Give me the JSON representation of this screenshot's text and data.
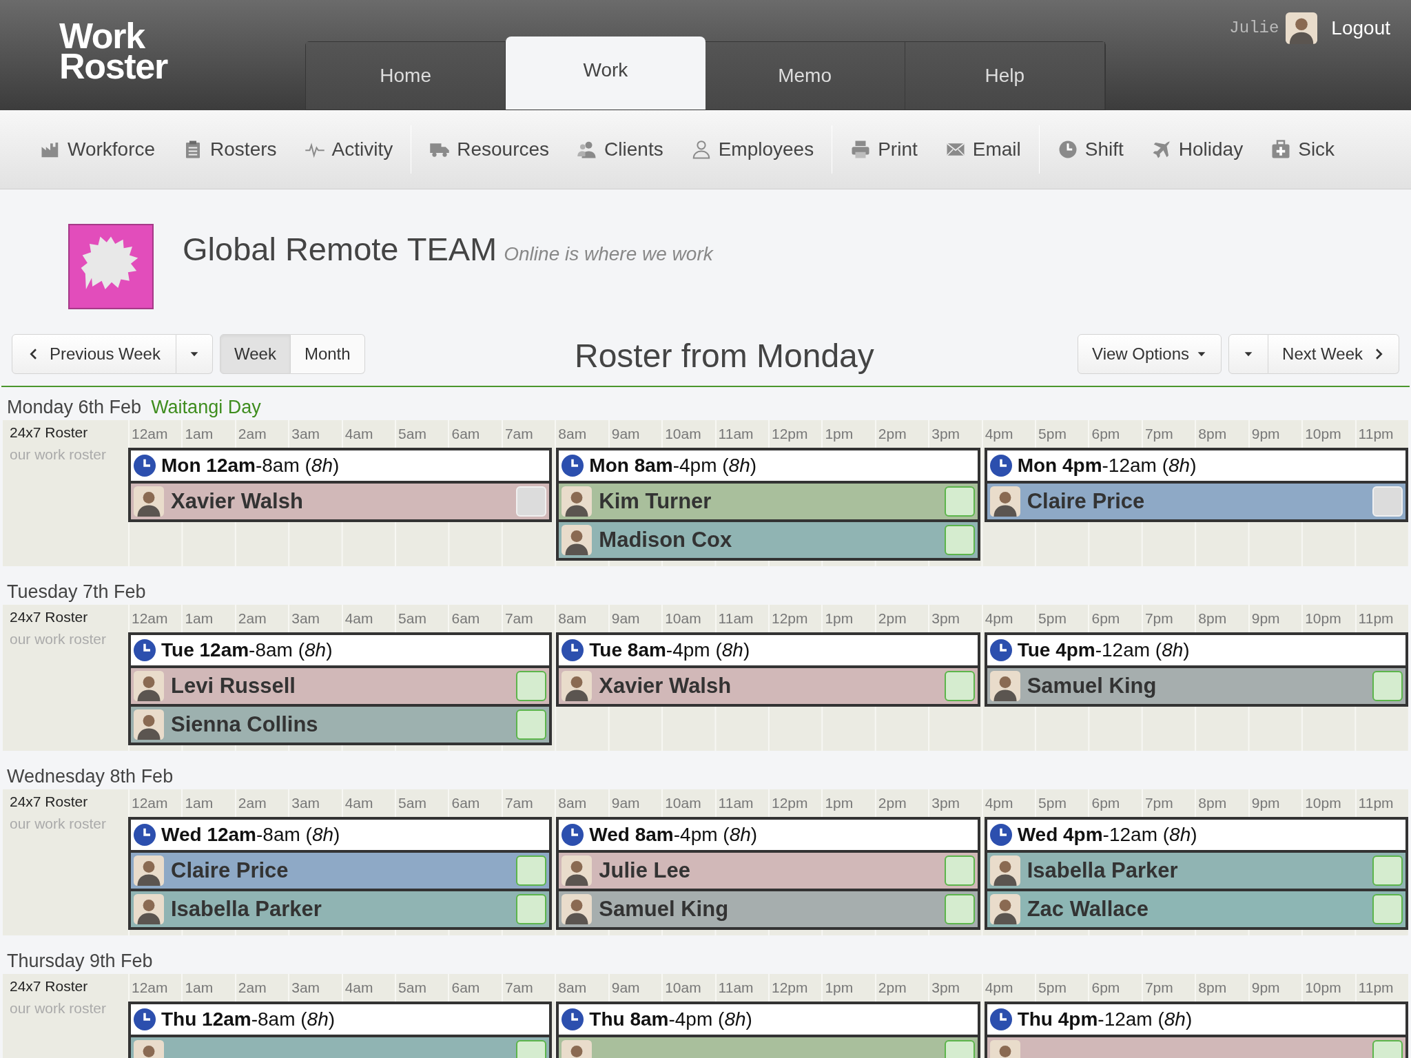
{
  "header": {
    "logo_lines": [
      "Work",
      "Roster"
    ],
    "tabs": [
      {
        "label": "Home",
        "selected": false
      },
      {
        "label": "Work",
        "selected": true
      },
      {
        "label": "Memo",
        "selected": false
      },
      {
        "label": "Help",
        "selected": false
      }
    ],
    "user": {
      "name": "Julie",
      "logout": "Logout"
    }
  },
  "toolbar": [
    [
      "Workforce",
      "Rosters",
      "Activity"
    ],
    [
      "Resources",
      "Clients",
      "Employees"
    ],
    [
      "Print",
      "Email"
    ],
    [
      "Shift",
      "Holiday",
      "Sick"
    ]
  ],
  "team": {
    "name": "Global Remote TEAM",
    "tagline": "Online is where we work"
  },
  "nav": {
    "previous": "Previous Week",
    "views": [
      {
        "label": "Week",
        "selected": true
      },
      {
        "label": "Month",
        "selected": false
      }
    ],
    "title": "Roster from Monday",
    "view_options": "View Options",
    "next": "Next Week"
  },
  "days": [
    {
      "title": "Monday 6th Feb",
      "holiday": "Waitangi Day",
      "roster": "24x7 Roster",
      "roster_note": "our work roster",
      "hours": [
        "12am",
        "1am",
        "2am",
        "3am",
        "4am",
        "5am",
        "6am",
        "7am",
        "8am",
        "9am",
        "10am",
        "11am",
        "12pm",
        "1pm",
        "2pm",
        "3pm",
        "4pm",
        "5pm",
        "6pm",
        "7pm",
        "8pm",
        "9pm",
        "10pm",
        "11pm"
      ],
      "shifts": [
        {
          "label": "**Mon 12am**-8am (*8h*)",
          "staff": [
            {
              "name": "Xavier Walsh",
              "color": "#d1b8b8",
              "confirmed": false
            }
          ]
        },
        {
          "label": "**Mon 8am**-4pm (*8h*)",
          "staff": [
            {
              "name": "Kim Turner",
              "color": "#a9bf9c",
              "confirmed": true
            },
            {
              "name": "Madison Cox",
              "color": "#90b4b3",
              "confirmed": true
            }
          ]
        },
        {
          "label": "**Mon 4pm**-12am (*8h*)",
          "staff": [
            {
              "name": "Claire Price",
              "color": "#8ea9c6",
              "confirmed": false
            }
          ]
        }
      ]
    },
    {
      "title": "Tuesday 7th Feb",
      "roster": "24x7 Roster",
      "roster_note": "our work roster",
      "hours": [
        "12am",
        "1am",
        "2am",
        "3am",
        "4am",
        "5am",
        "6am",
        "7am",
        "8am",
        "9am",
        "10am",
        "11am",
        "12pm",
        "1pm",
        "2pm",
        "3pm",
        "4pm",
        "5pm",
        "6pm",
        "7pm",
        "8pm",
        "9pm",
        "10pm",
        "11pm"
      ],
      "shifts": [
        {
          "label": "**Tue 12am**-8am (*8h*)",
          "staff": [
            {
              "name": "Levi Russell",
              "color": "#d1b8b8",
              "confirmed": true
            },
            {
              "name": "Sienna Collins",
              "color": "#9db1af",
              "confirmed": true
            }
          ]
        },
        {
          "label": "**Tue 8am**-4pm (*8h*)",
          "staff": [
            {
              "name": "Xavier Walsh",
              "color": "#d1b8b8",
              "confirmed": true
            }
          ]
        },
        {
          "label": "**Tue 4pm**-12am (*8h*)",
          "staff": [
            {
              "name": "Samuel King",
              "color": "#a6aeae",
              "confirmed": true
            }
          ]
        }
      ]
    },
    {
      "title": "Wednesday 8th Feb",
      "roster": "24x7 Roster",
      "roster_note": "our work roster",
      "hours": [
        "12am",
        "1am",
        "2am",
        "3am",
        "4am",
        "5am",
        "6am",
        "7am",
        "8am",
        "9am",
        "10am",
        "11am",
        "12pm",
        "1pm",
        "2pm",
        "3pm",
        "4pm",
        "5pm",
        "6pm",
        "7pm",
        "8pm",
        "9pm",
        "10pm",
        "11pm"
      ],
      "shifts": [
        {
          "label": "**Wed 12am**-8am (*8h*)",
          "staff": [
            {
              "name": "Claire Price",
              "color": "#8ea9c6",
              "confirmed": true
            },
            {
              "name": "Isabella Parker",
              "color": "#90b4b3",
              "confirmed": true
            }
          ]
        },
        {
          "label": "**Wed 8am**-4pm (*8h*)",
          "staff": [
            {
              "name": "Julie Lee",
              "color": "#d1b8b8",
              "confirmed": true
            },
            {
              "name": "Samuel King",
              "color": "#a6aeae",
              "confirmed": true
            }
          ]
        },
        {
          "label": "**Wed 4pm**-12am (*8h*)",
          "staff": [
            {
              "name": "Isabella Parker",
              "color": "#90b4b3",
              "confirmed": true
            },
            {
              "name": "Zac Wallace",
              "color": "#8db6b4",
              "confirmed": true
            }
          ]
        }
      ]
    },
    {
      "title": "Thursday 9th Feb",
      "roster": "24x7 Roster",
      "roster_note": "our work roster",
      "hours": [
        "12am",
        "1am",
        "2am",
        "3am",
        "4am",
        "5am",
        "6am",
        "7am",
        "8am",
        "9am",
        "10am",
        "11am",
        "12pm",
        "1pm",
        "2pm",
        "3pm",
        "4pm",
        "5pm",
        "6pm",
        "7pm",
        "8pm",
        "9pm",
        "10pm",
        "11pm"
      ],
      "shifts": [
        {
          "label": "**Thu 12am**-8am (*8h*)",
          "staff": [
            {
              "color": "#90b4b3",
              "confirmed": true
            }
          ]
        },
        {
          "label": "**Thu 8am**-4pm (*8h*)",
          "staff": [
            {
              "color": "#a9bf9c",
              "confirmed": true
            }
          ]
        },
        {
          "label": "**Thu 4pm**-12am (*8h*)",
          "staff": [
            {
              "color": "#d1b8b8",
              "confirmed": true
            }
          ]
        }
      ]
    }
  ]
}
